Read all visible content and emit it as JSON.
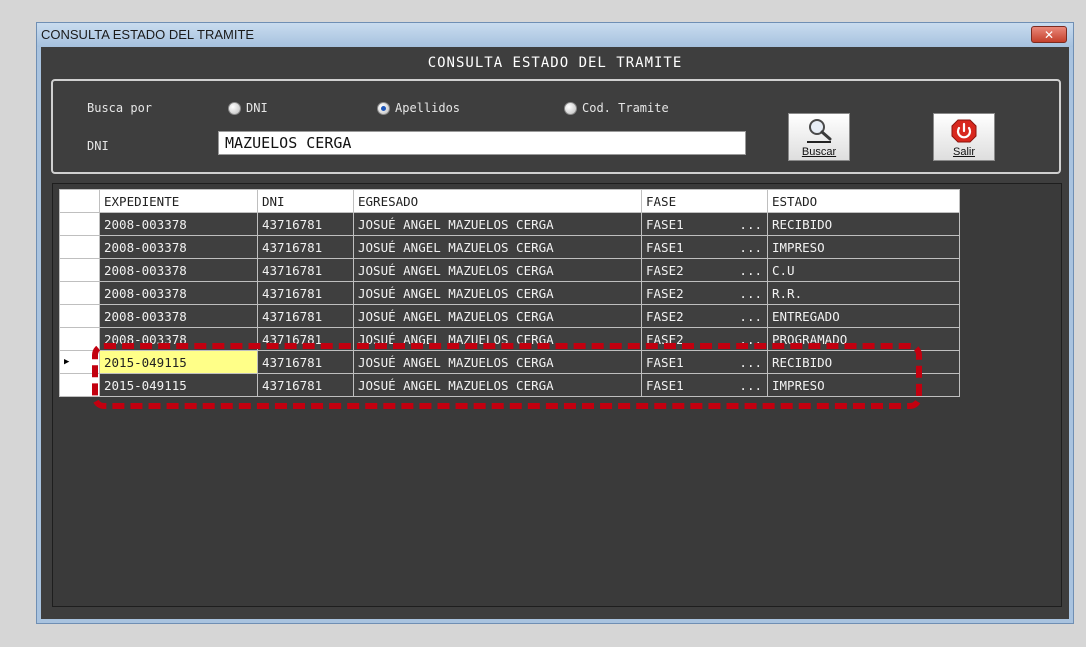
{
  "window": {
    "title": "CONSULTA ESTADO DEL TRAMITE",
    "close_glyph": "✕"
  },
  "form": {
    "heading": "CONSULTA ESTADO DEL TRAMITE",
    "search_by_label": "Busca por",
    "radio_options": [
      {
        "label": "DNI",
        "checked": false
      },
      {
        "label": "Apellidos",
        "checked": true
      },
      {
        "label": "Cod. Tramite",
        "checked": false
      }
    ],
    "field_label": "DNI",
    "field_value": "MAZUELOS CERGA",
    "buttons": {
      "search_label": "Buscar",
      "search_icon": "magnifier-icon",
      "exit_label": "Salir",
      "exit_icon": "power-icon"
    }
  },
  "grid": {
    "columns": [
      "EXPEDIENTE",
      "DNI",
      "EGRESADO",
      "FASE",
      "ESTADO"
    ],
    "ellipsis": "...",
    "rows": [
      {
        "expediente": "2008-003378",
        "dni": "43716781",
        "egresado": "JOSUÉ ANGEL MAZUELOS CERGA",
        "fase": "FASE1",
        "estado": "RECIBIDO"
      },
      {
        "expediente": "2008-003378",
        "dni": "43716781",
        "egresado": "JOSUÉ ANGEL MAZUELOS CERGA",
        "fase": "FASE1",
        "estado": "IMPRESO"
      },
      {
        "expediente": "2008-003378",
        "dni": "43716781",
        "egresado": "JOSUÉ ANGEL MAZUELOS CERGA",
        "fase": "FASE2",
        "estado": "C.U"
      },
      {
        "expediente": "2008-003378",
        "dni": "43716781",
        "egresado": "JOSUÉ ANGEL MAZUELOS CERGA",
        "fase": "FASE2",
        "estado": "R.R."
      },
      {
        "expediente": "2008-003378",
        "dni": "43716781",
        "egresado": "JOSUÉ ANGEL MAZUELOS CERGA",
        "fase": "FASE2",
        "estado": "ENTREGADO"
      },
      {
        "expediente": "2008-003378",
        "dni": "43716781",
        "egresado": "JOSUÉ ANGEL MAZUELOS CERGA",
        "fase": "FASE2",
        "estado": "PROGRAMADO"
      },
      {
        "expediente": "2015-049115",
        "dni": "43716781",
        "egresado": "JOSUÉ ANGEL MAZUELOS CERGA",
        "fase": "FASE1",
        "estado": "RECIBIDO",
        "current": true
      },
      {
        "expediente": "2015-049115",
        "dni": "43716781",
        "egresado": "JOSUÉ ANGEL MAZUELOS CERGA",
        "fase": "FASE1",
        "estado": "IMPRESO"
      }
    ]
  },
  "colors": {
    "highlight_outline": "#c2000f",
    "selected_cell": "#ffff88"
  }
}
